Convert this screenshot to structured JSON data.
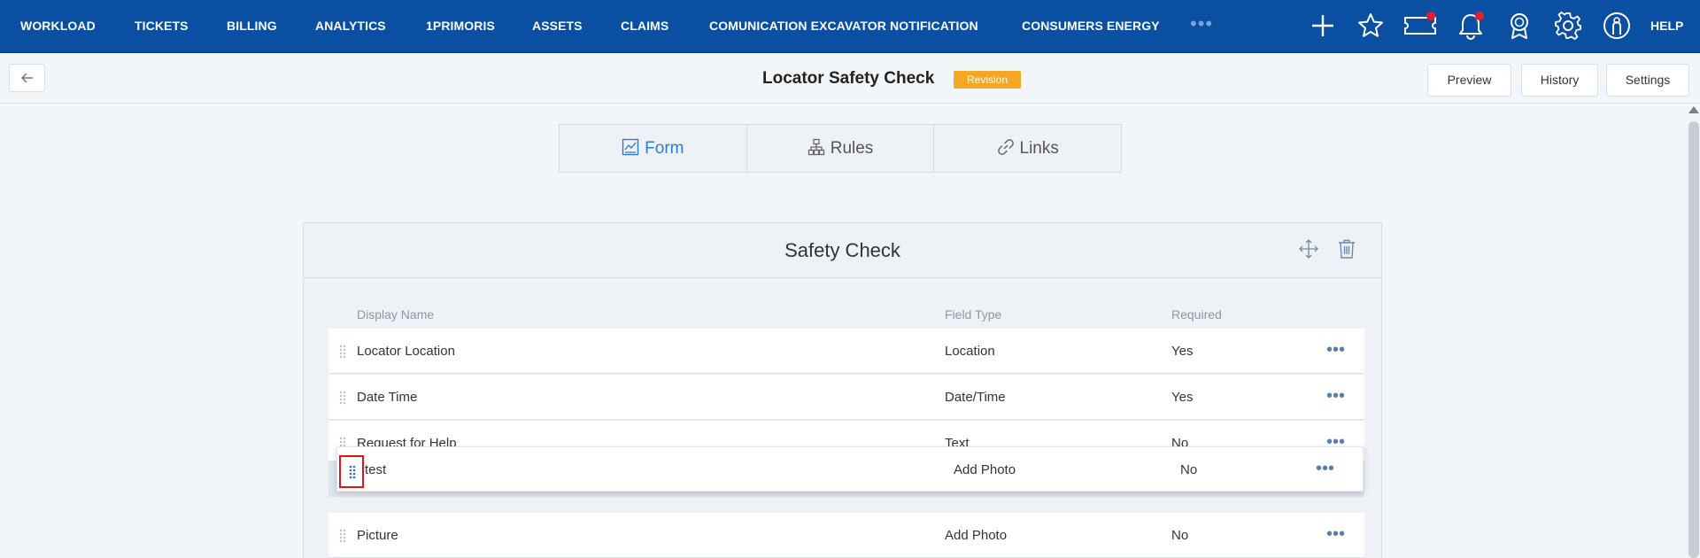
{
  "nav": {
    "items": [
      {
        "label": "WORKLOAD"
      },
      {
        "label": "TICKETS"
      },
      {
        "label": "BILLING"
      },
      {
        "label": "ANALYTICS"
      },
      {
        "label": "1PRIMORIS"
      },
      {
        "label": "ASSETS"
      },
      {
        "label": "CLAIMS"
      },
      {
        "label": "COMUNICATION EXCAVATOR NOTIFICATION"
      },
      {
        "label": "CONSUMERS ENERGY"
      }
    ],
    "more": "•••",
    "icons": [
      "plus-icon",
      "star-icon",
      "ticket-icon",
      "bell-icon",
      "award-icon",
      "gear-icon",
      "user-icon"
    ],
    "help": "HELP",
    "colors": {
      "bar": "#0b4fa3",
      "notification": "#e5202e"
    }
  },
  "header": {
    "title": "Locator Safety Check",
    "badge": "Revision",
    "buttons": {
      "preview": "Preview",
      "history": "History",
      "settings": "Settings"
    }
  },
  "tabs": [
    {
      "label": "Form",
      "icon": "form-icon",
      "active": true
    },
    {
      "label": "Rules",
      "icon": "hierarchy-icon",
      "active": false
    },
    {
      "label": "Links",
      "icon": "link-icon",
      "active": false
    }
  ],
  "section": {
    "title": "Safety Check",
    "columns": {
      "display_name": "Display Name",
      "field_type": "Field Type",
      "required": "Required"
    },
    "rows": [
      {
        "name": "Locator Location",
        "type": "Location",
        "required": "Yes"
      },
      {
        "name": "Date Time",
        "type": "Date/Time",
        "required": "Yes"
      },
      {
        "name": "Request for Help",
        "type": "Text",
        "required": "No"
      },
      {
        "name": "Picture",
        "type": "Add Photo",
        "required": "No"
      }
    ],
    "dragging_row": {
      "name": "test",
      "type": "Add Photo",
      "required": "No"
    }
  }
}
